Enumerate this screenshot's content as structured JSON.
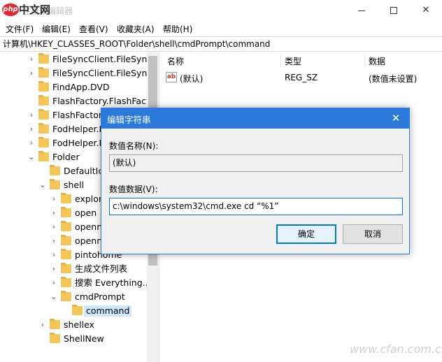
{
  "window": {
    "title": "注册表编辑器",
    "watermark_logo": "php中文网",
    "controls": {
      "minimize": "—",
      "maximize": "☐",
      "close": "✕"
    }
  },
  "menu": [
    "文件(F)",
    "编辑(E)",
    "查看(V)",
    "收藏夹(A)",
    "帮助(H)"
  ],
  "address": "计算机\\HKEY_CLASSES_ROOT\\Folder\\shell\\cmdPrompt\\command",
  "tree": {
    "items": [
      {
        "label": "FileSyncClient.FileSyncC",
        "expander": "›",
        "selected": false
      },
      {
        "label": "FileSyncClient.FileSyncC",
        "expander": "›",
        "selected": false
      },
      {
        "label": "FindApp.DVD",
        "expander": "",
        "selected": false
      },
      {
        "label": "FlashFactory.FlashFacto",
        "expander": "",
        "selected": false
      },
      {
        "label": "FlashFactory.F",
        "expander": "›",
        "selected": false
      },
      {
        "label": "FodHelper.F",
        "expander": "›",
        "selected": false
      },
      {
        "label": "FodHelper.F",
        "expander": "›",
        "selected": false
      },
      {
        "label": "Folder",
        "expander": "⌄",
        "selected": false
      },
      {
        "label": "DefaultIco",
        "expander": "",
        "selected": false
      },
      {
        "label": "shell",
        "expander": "⌄",
        "selected": false
      },
      {
        "label": "explor",
        "expander": "›",
        "selected": false
      },
      {
        "label": "open",
        "expander": "›",
        "selected": false
      },
      {
        "label": "openn",
        "expander": "›",
        "selected": false
      },
      {
        "label": "openn",
        "expander": "›",
        "selected": false
      },
      {
        "label": "pintohome",
        "expander": "›",
        "selected": false
      },
      {
        "label": "生成文件列表",
        "expander": "›",
        "selected": false
      },
      {
        "label": "搜索 Everything...",
        "expander": "›",
        "selected": false
      },
      {
        "label": "cmdPrompt",
        "expander": "⌄",
        "selected": false
      },
      {
        "label": "command",
        "expander": "",
        "selected": true
      },
      {
        "label": "shellex",
        "expander": "›",
        "selected": false
      },
      {
        "label": "ShellNew",
        "expander": "",
        "selected": false
      }
    ]
  },
  "list": {
    "headers": {
      "name": "名称",
      "type": "类型",
      "data": "数据"
    },
    "rows": [
      {
        "icon": "ab",
        "name": "(默认)",
        "type": "REG_SZ",
        "data": "(数值未设置)"
      }
    ]
  },
  "dialog": {
    "title": "编辑字符串",
    "close": "✕",
    "name_label": "数值名称(N):",
    "name_value": "(默认)",
    "data_label": "数值数据(V):",
    "data_value": "c:\\windows\\system32\\cmd.exe cd “%1”",
    "ok_label": "确定",
    "cancel_label": "取消"
  },
  "watermark": "www.cfan.com.cn",
  "colors": {
    "dialog_title_bg": "#2b79d8",
    "folder": "#f4c658",
    "selection": "#cce8ff",
    "focus_border": "#0078d7"
  }
}
